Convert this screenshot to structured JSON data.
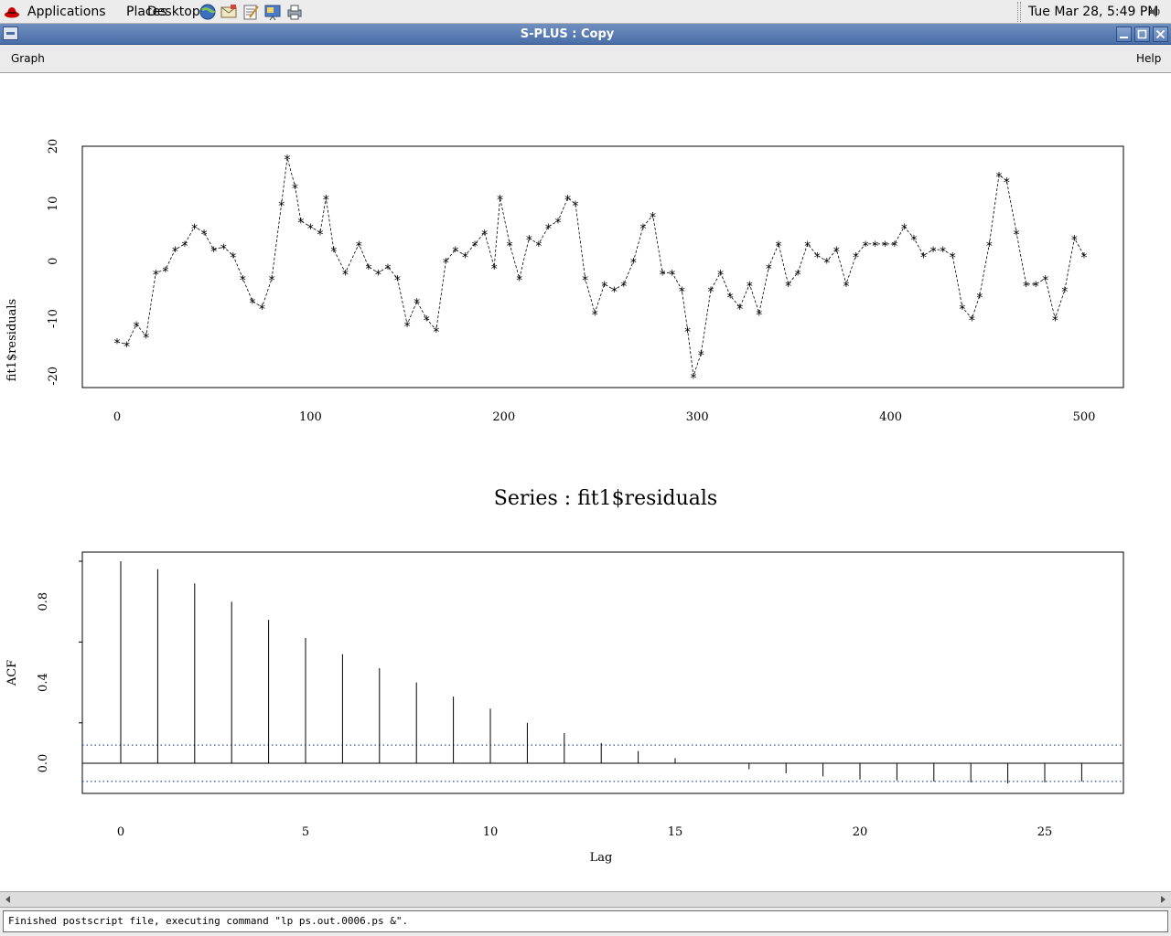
{
  "top_panel": {
    "menus": [
      "Applications",
      "Places",
      "Desktop"
    ],
    "launchers": [
      "web-browser-icon",
      "email-icon",
      "text-editor-icon",
      "presentation-icon",
      "printer-icon"
    ],
    "clock": "Tue Mar 28,  5:49 PM"
  },
  "window": {
    "title": "S-PLUS : Copy",
    "menus": {
      "graph": "Graph",
      "help": "Help"
    }
  },
  "residual_plot": {
    "ylabel": "fit1$residuals",
    "xticks": [
      "0",
      "100",
      "200",
      "300",
      "400",
      "500"
    ],
    "yticks": [
      "-20",
      "-10",
      "0",
      "10",
      "20"
    ]
  },
  "acf_plot": {
    "title": "Series : fit1$residuals",
    "xlabel": "Lag",
    "ylabel": "ACF",
    "xticks": [
      "0",
      "5",
      "10",
      "15",
      "20",
      "25"
    ],
    "yticks": [
      "0.0",
      "0.4",
      "0.8"
    ]
  },
  "chart_data": [
    {
      "type": "line",
      "marker": "*",
      "line_style": "dashed",
      "ylabel": "fit1$residuals",
      "xlim": [
        0,
        500
      ],
      "ylim": [
        -22,
        20
      ],
      "x": [
        0,
        5,
        10,
        15,
        20,
        25,
        30,
        35,
        40,
        45,
        50,
        55,
        60,
        65,
        70,
        75,
        80,
        85,
        88,
        92,
        95,
        100,
        105,
        108,
        112,
        118,
        125,
        130,
        135,
        140,
        145,
        150,
        155,
        160,
        165,
        170,
        175,
        180,
        185,
        190,
        195,
        198,
        203,
        208,
        213,
        218,
        223,
        228,
        233,
        237,
        242,
        247,
        252,
        257,
        262,
        267,
        272,
        277,
        282,
        287,
        292,
        295,
        298,
        302,
        307,
        312,
        317,
        322,
        327,
        332,
        337,
        342,
        347,
        352,
        357,
        362,
        367,
        372,
        377,
        382,
        387,
        392,
        397,
        402,
        407,
        412,
        417,
        422,
        427,
        432,
        437,
        442,
        446,
        451,
        456,
        460,
        465,
        470,
        475,
        480,
        485,
        490,
        495,
        500
      ],
      "y": [
        -14,
        -14.5,
        -11,
        -13,
        -2,
        -1.5,
        2,
        3,
        6,
        5,
        2,
        2.5,
        1,
        -3,
        -7,
        -8,
        -3,
        10,
        18,
        13,
        7,
        6,
        5,
        11,
        2,
        -2,
        3,
        -1,
        -2,
        -1,
        -3,
        -11,
        -7,
        -10,
        -12,
        0,
        2,
        1,
        3,
        5,
        -1,
        11,
        3,
        -3,
        4,
        3,
        6,
        7,
        11,
        10,
        -3,
        -9,
        -4,
        -5,
        -4,
        0,
        6,
        8,
        -2,
        -2,
        -5,
        -12,
        -20,
        -16,
        -5,
        -2,
        -6,
        -8,
        -4,
        -9,
        -1,
        3,
        -4,
        -2,
        3,
        1,
        0,
        2,
        -4,
        1,
        3,
        3,
        3,
        3,
        6,
        4,
        1,
        2,
        2,
        1,
        -8,
        -10,
        -6,
        3,
        15,
        14,
        5,
        -4,
        -4,
        -3,
        -10,
        -5,
        4,
        1
      ]
    },
    {
      "type": "bar",
      "title": "Series : fit1$residuals",
      "xlabel": "Lag",
      "ylabel": "ACF",
      "xlim": [
        -1,
        27
      ],
      "ylim": [
        -0.15,
        1.05
      ],
      "lags": [
        0,
        1,
        2,
        3,
        4,
        5,
        6,
        7,
        8,
        9,
        10,
        11,
        12,
        13,
        14,
        15,
        16,
        17,
        18,
        19,
        20,
        21,
        22,
        23,
        24,
        25,
        26
      ],
      "acf": [
        1.0,
        0.96,
        0.89,
        0.8,
        0.71,
        0.62,
        0.54,
        0.47,
        0.4,
        0.33,
        0.27,
        0.2,
        0.15,
        0.1,
        0.06,
        0.025,
        0.0,
        -0.03,
        -0.05,
        -0.065,
        -0.08,
        -0.085,
        -0.09,
        -0.095,
        -0.1,
        -0.095,
        -0.09
      ],
      "confidence_band": 0.09,
      "confidence_style": "dotted"
    }
  ],
  "status": {
    "text": "Finished postscript file, executing command \"lp ps.out.0006.ps &\"."
  },
  "colors": {
    "titlebar": "#4a6ea8",
    "confidence_band": "#2b4f9a"
  }
}
